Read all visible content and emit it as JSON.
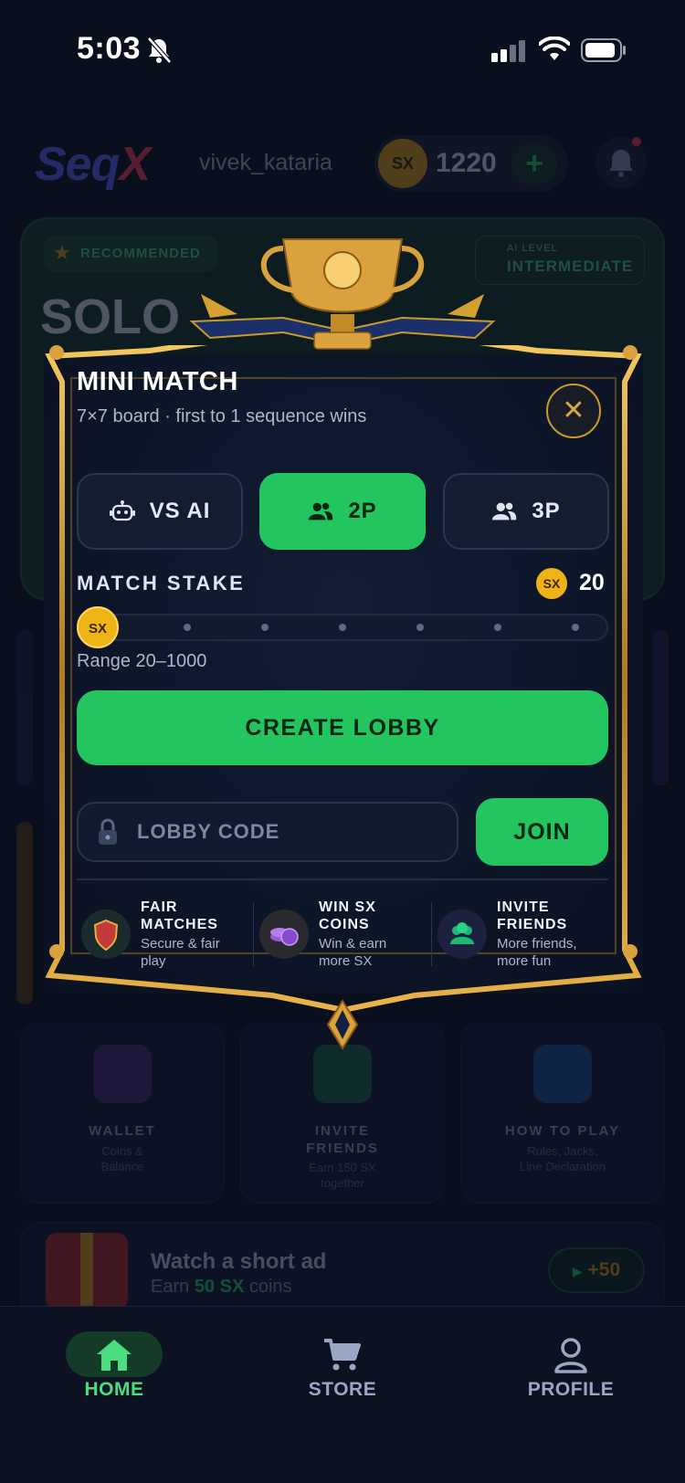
{
  "status_bar": {
    "time": "5:03"
  },
  "background": {
    "brand_part1": "Seq",
    "brand_part2": "X",
    "username": "vivek_kataria",
    "coin_badge": "SX",
    "coin_balance": "1220",
    "plus": "+",
    "solo_card": {
      "recommended": "RECOMMENDED",
      "ai_level_label": "AI LEVEL",
      "ai_level_value": "INTERMEDIATE",
      "title": "SOLO"
    },
    "tiles": [
      {
        "title": "WALLET",
        "subtitle_line1": "Coins &",
        "subtitle_line2": "Balance"
      },
      {
        "title_line1": "INVITE",
        "title_line2": "FRIENDS",
        "subtitle_line1": "Earn 150 SX",
        "subtitle_line2": "together"
      },
      {
        "title": "HOW TO PLAY",
        "subtitle_line1": "Rules, Jacks,",
        "subtitle_line2": "Line Declaration"
      }
    ],
    "ad": {
      "title": "Watch a short ad",
      "subtitle_prefix": "Earn",
      "subtitle_amount": "50 SX",
      "subtitle_suffix": "coins",
      "reward_button": "+50",
      "play_glyph": "▶"
    }
  },
  "modal": {
    "title": "MINI MATCH",
    "subtitle": "7×7 board · first to 1 sequence wins",
    "close_glyph": "✕",
    "modes": [
      {
        "label": "VS AI",
        "icon": "robot-icon",
        "active": false
      },
      {
        "label": "2P",
        "icon": "users-icon",
        "active": true
      },
      {
        "label": "3P",
        "icon": "users-icon",
        "active": false
      }
    ],
    "stake": {
      "label": "MATCH STAKE",
      "coin_badge": "SX",
      "value": "20",
      "range_text": "Range 20–1000",
      "slider_fraction": 0.0,
      "thumb_badge": "SX"
    },
    "create_lobby_label": "CREATE LOBBY",
    "lobby_code_placeholder": "LOBBY CODE",
    "join_label": "JOIN",
    "features": [
      {
        "title_line1": "FAIR",
        "title_line2": "MATCHES",
        "sub_line1": "Secure & fair",
        "sub_line2": "play",
        "icon": "shield-icon"
      },
      {
        "title_line1": "WIN SX",
        "title_line2": "COINS",
        "sub_line1": "Win & earn",
        "sub_line2": "more SX",
        "icon": "coins-icon"
      },
      {
        "title_line1": "INVITE",
        "title_line2": "FRIENDS",
        "sub_line1": "More friends,",
        "sub_line2": "more fun",
        "icon": "friends-icon"
      }
    ]
  },
  "bottom_nav": [
    {
      "label": "HOME",
      "icon": "home-icon",
      "active": true
    },
    {
      "label": "STORE",
      "icon": "cart-icon",
      "active": false
    },
    {
      "label": "PROFILE",
      "icon": "user-icon",
      "active": false
    }
  ],
  "colors": {
    "accent_green": "#22c55e",
    "gold": "#d7a93a",
    "coin": "#f0b316",
    "background": "#0a0f1e"
  }
}
